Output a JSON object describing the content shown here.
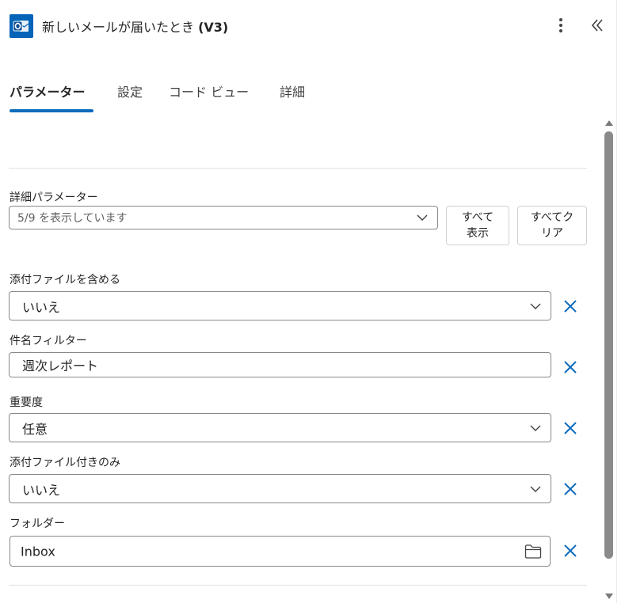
{
  "header": {
    "title_prefix": "新しいメールが届いたとき ",
    "title_version": "(V3)"
  },
  "tabs": [
    {
      "label": "パラメーター",
      "active": true
    },
    {
      "label": "設定",
      "active": false
    },
    {
      "label": "コード ビュー",
      "active": false
    },
    {
      "label": "詳細",
      "active": false
    }
  ],
  "advanced": {
    "label": "詳細パラメーター",
    "dropdown_value": "5/9 を表示しています",
    "show_all": "すべて\n表示",
    "clear_all": "すべてク\nリア"
  },
  "params": [
    {
      "label": "添付ファイルを含める",
      "value": "いいえ",
      "kind": "dropdown"
    },
    {
      "label": "件名フィルター",
      "value": "週次レポート",
      "kind": "text"
    },
    {
      "label": "重要度",
      "value": "任意",
      "kind": "dropdown"
    },
    {
      "label": "添付ファイル付きのみ",
      "value": "いいえ",
      "kind": "dropdown"
    },
    {
      "label": "フォルダー",
      "value": "Inbox",
      "kind": "folder"
    }
  ],
  "colors": {
    "accent": "#0f6cbd",
    "outlook": "#0364b8"
  }
}
